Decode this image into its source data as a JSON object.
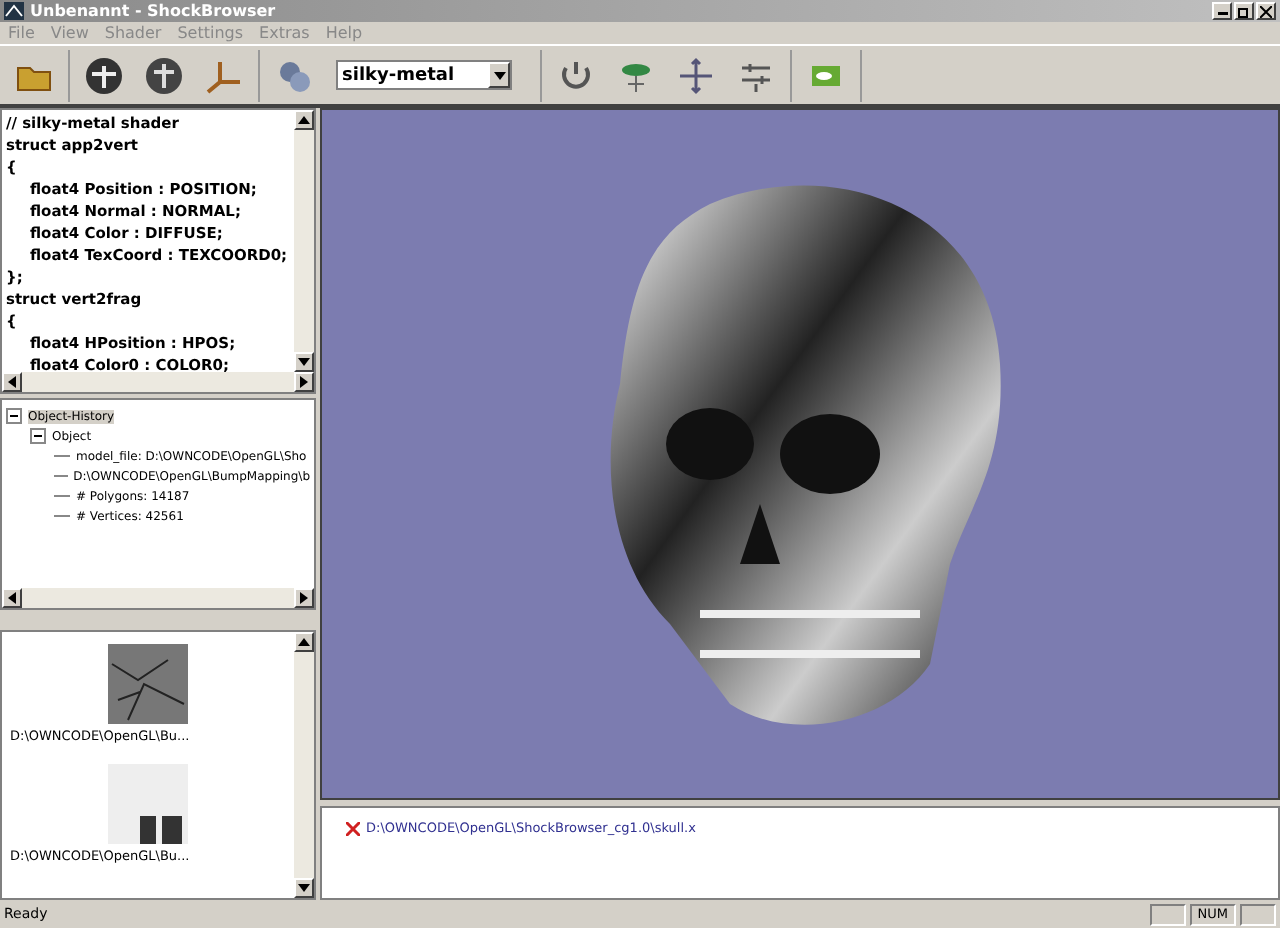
{
  "window": {
    "title": "Unbenannt - ShockBrowser"
  },
  "menu": [
    "File",
    "View",
    "Shader",
    "Settings",
    "Extras",
    "Help"
  ],
  "toolbar": {
    "shader_select": {
      "value": "silky-metal"
    }
  },
  "code_lines": [
    {
      "text": "// silky-metal shader",
      "indent": false
    },
    {
      "text": "struct app2vert",
      "indent": false
    },
    {
      "text": "{",
      "indent": false
    },
    {
      "text": "float4 Position : POSITION;",
      "indent": true
    },
    {
      "text": "float4 Normal : NORMAL;",
      "indent": true
    },
    {
      "text": "float4 Color : DIFFUSE;",
      "indent": true
    },
    {
      "text": "float4 TexCoord : TEXCOORD0;",
      "indent": true
    },
    {
      "text": "};",
      "indent": false
    },
    {
      "text": "struct vert2frag",
      "indent": false
    },
    {
      "text": "{",
      "indent": false
    },
    {
      "text": "float4 HPosition : HPOS;",
      "indent": true
    },
    {
      "text": "float4 Color0 : COLOR0;",
      "indent": true
    }
  ],
  "tree": [
    {
      "label": "Object-History",
      "expanded": true,
      "selected": true,
      "children": [
        {
          "label": "Object",
          "expanded": true,
          "selected": false,
          "children": [
            {
              "label": "model_file: D:\\OWNCODE\\OpenGL\\Sho",
              "selected": false
            },
            {
              "label": "D:\\OWNCODE\\OpenGL\\BumpMapping\\b",
              "selected": false
            },
            {
              "label": "# Polygons: 14187",
              "selected": false
            },
            {
              "label": "# Vertices: 42561",
              "selected": false
            }
          ]
        }
      ]
    }
  ],
  "textures": [
    {
      "kind": "rock",
      "caption": "D:\\OWNCODE\\OpenGL\\Bu..."
    },
    {
      "kind": "letters",
      "caption": "D:\\OWNCODE\\OpenGL\\Bu..."
    }
  ],
  "output": [
    {
      "kind": "error",
      "text": "D:\\OWNCODE\\OpenGL\\ShockBrowser_cg1.0\\skull.x"
    }
  ],
  "status_bar": {
    "text": "Ready",
    "indicators": [
      "NUM"
    ]
  }
}
